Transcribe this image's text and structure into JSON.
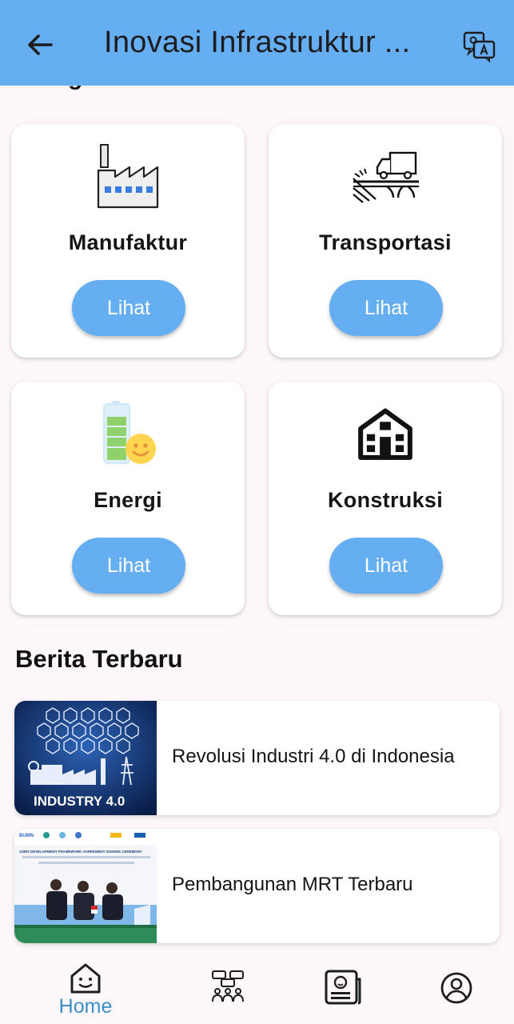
{
  "appbar": {
    "title": "Inovasi Infrastruktur ...",
    "back_icon": "arrow-back-icon",
    "translate_icon": "translate-icon"
  },
  "categories_heading_partial": "Kategori Dan",
  "categories": [
    {
      "label": "Manufaktur",
      "button": "Lihat",
      "icon": "factory-icon"
    },
    {
      "label": "Transportasi",
      "button": "Lihat",
      "icon": "truck-bridge-icon"
    },
    {
      "label": "Energi",
      "button": "Lihat",
      "icon": "battery-smile-icon"
    },
    {
      "label": "Konstruksi",
      "button": "Lihat",
      "icon": "building-icon"
    }
  ],
  "news": {
    "heading": "Berita Terbaru",
    "items": [
      {
        "title": "Revolusi Industri 4.0 di Indonesia",
        "thumb_caption": "INDUSTRY 4.0"
      },
      {
        "title": "Pembangunan MRT Terbaru",
        "thumb_caption": "JOINT DEVELOPMENT FRAMEWORK AGREEMENT SIGNING CEREMONY"
      }
    ]
  },
  "bottom_nav": {
    "items": [
      {
        "label": "Home",
        "icon": "home-face-icon",
        "active": true
      },
      {
        "label": "",
        "icon": "community-icon"
      },
      {
        "label": "",
        "icon": "news-icon"
      },
      {
        "label": "",
        "icon": "profile-icon"
      }
    ],
    "active_color": "#3b8fc9"
  },
  "colors": {
    "accent": "#64aef1",
    "background": "#fdf7fb"
  }
}
